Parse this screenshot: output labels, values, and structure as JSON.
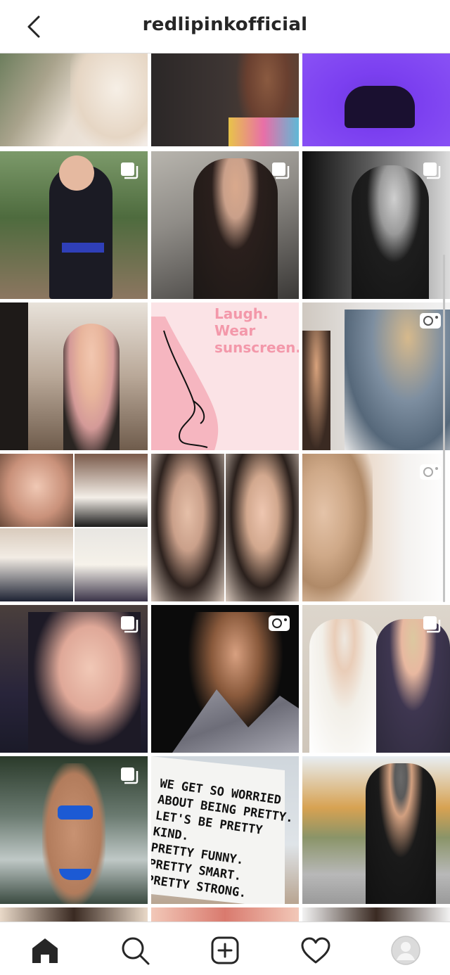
{
  "header": {
    "title": "redlipinkofficial",
    "back_icon": "chevron-left-icon"
  },
  "grid": {
    "tiles": [
      {
        "name": "post-1",
        "badge": "none"
      },
      {
        "name": "post-2",
        "badge": "none"
      },
      {
        "name": "post-3",
        "badge": "none"
      },
      {
        "name": "post-4",
        "badge": "carousel-icon"
      },
      {
        "name": "post-5",
        "badge": "carousel-icon"
      },
      {
        "name": "post-6",
        "badge": "carousel-icon"
      },
      {
        "name": "post-7",
        "badge": "none"
      },
      {
        "name": "post-8",
        "badge": "none",
        "text": "Laugh.\nWear sunscreen."
      },
      {
        "name": "post-9",
        "badge": "video-icon"
      },
      {
        "name": "post-10",
        "badge": "none"
      },
      {
        "name": "post-11",
        "badge": "none"
      },
      {
        "name": "post-12",
        "badge": "video-icon"
      },
      {
        "name": "post-13",
        "badge": "carousel-icon"
      },
      {
        "name": "post-14",
        "badge": "video-icon"
      },
      {
        "name": "post-15",
        "badge": "carousel-icon"
      },
      {
        "name": "post-16",
        "badge": "carousel-icon"
      },
      {
        "name": "post-17",
        "badge": "none",
        "text": "WE GET SO WORRIED\nABOUT BEING PRETTY.\nLET'S BE PRETTY KIND.\nPRETTY FUNNY.\nPRETTY SMART.\nPRETTY STRONG."
      },
      {
        "name": "post-18",
        "badge": "none"
      }
    ]
  },
  "bottom_nav": {
    "items": [
      {
        "name": "home",
        "icon": "home-icon",
        "active": true
      },
      {
        "name": "search",
        "icon": "search-icon",
        "active": false
      },
      {
        "name": "new-post",
        "icon": "plus-square-icon",
        "active": false
      },
      {
        "name": "activity",
        "icon": "heart-icon",
        "active": false
      },
      {
        "name": "profile",
        "icon": "avatar-icon",
        "active": false
      }
    ]
  }
}
